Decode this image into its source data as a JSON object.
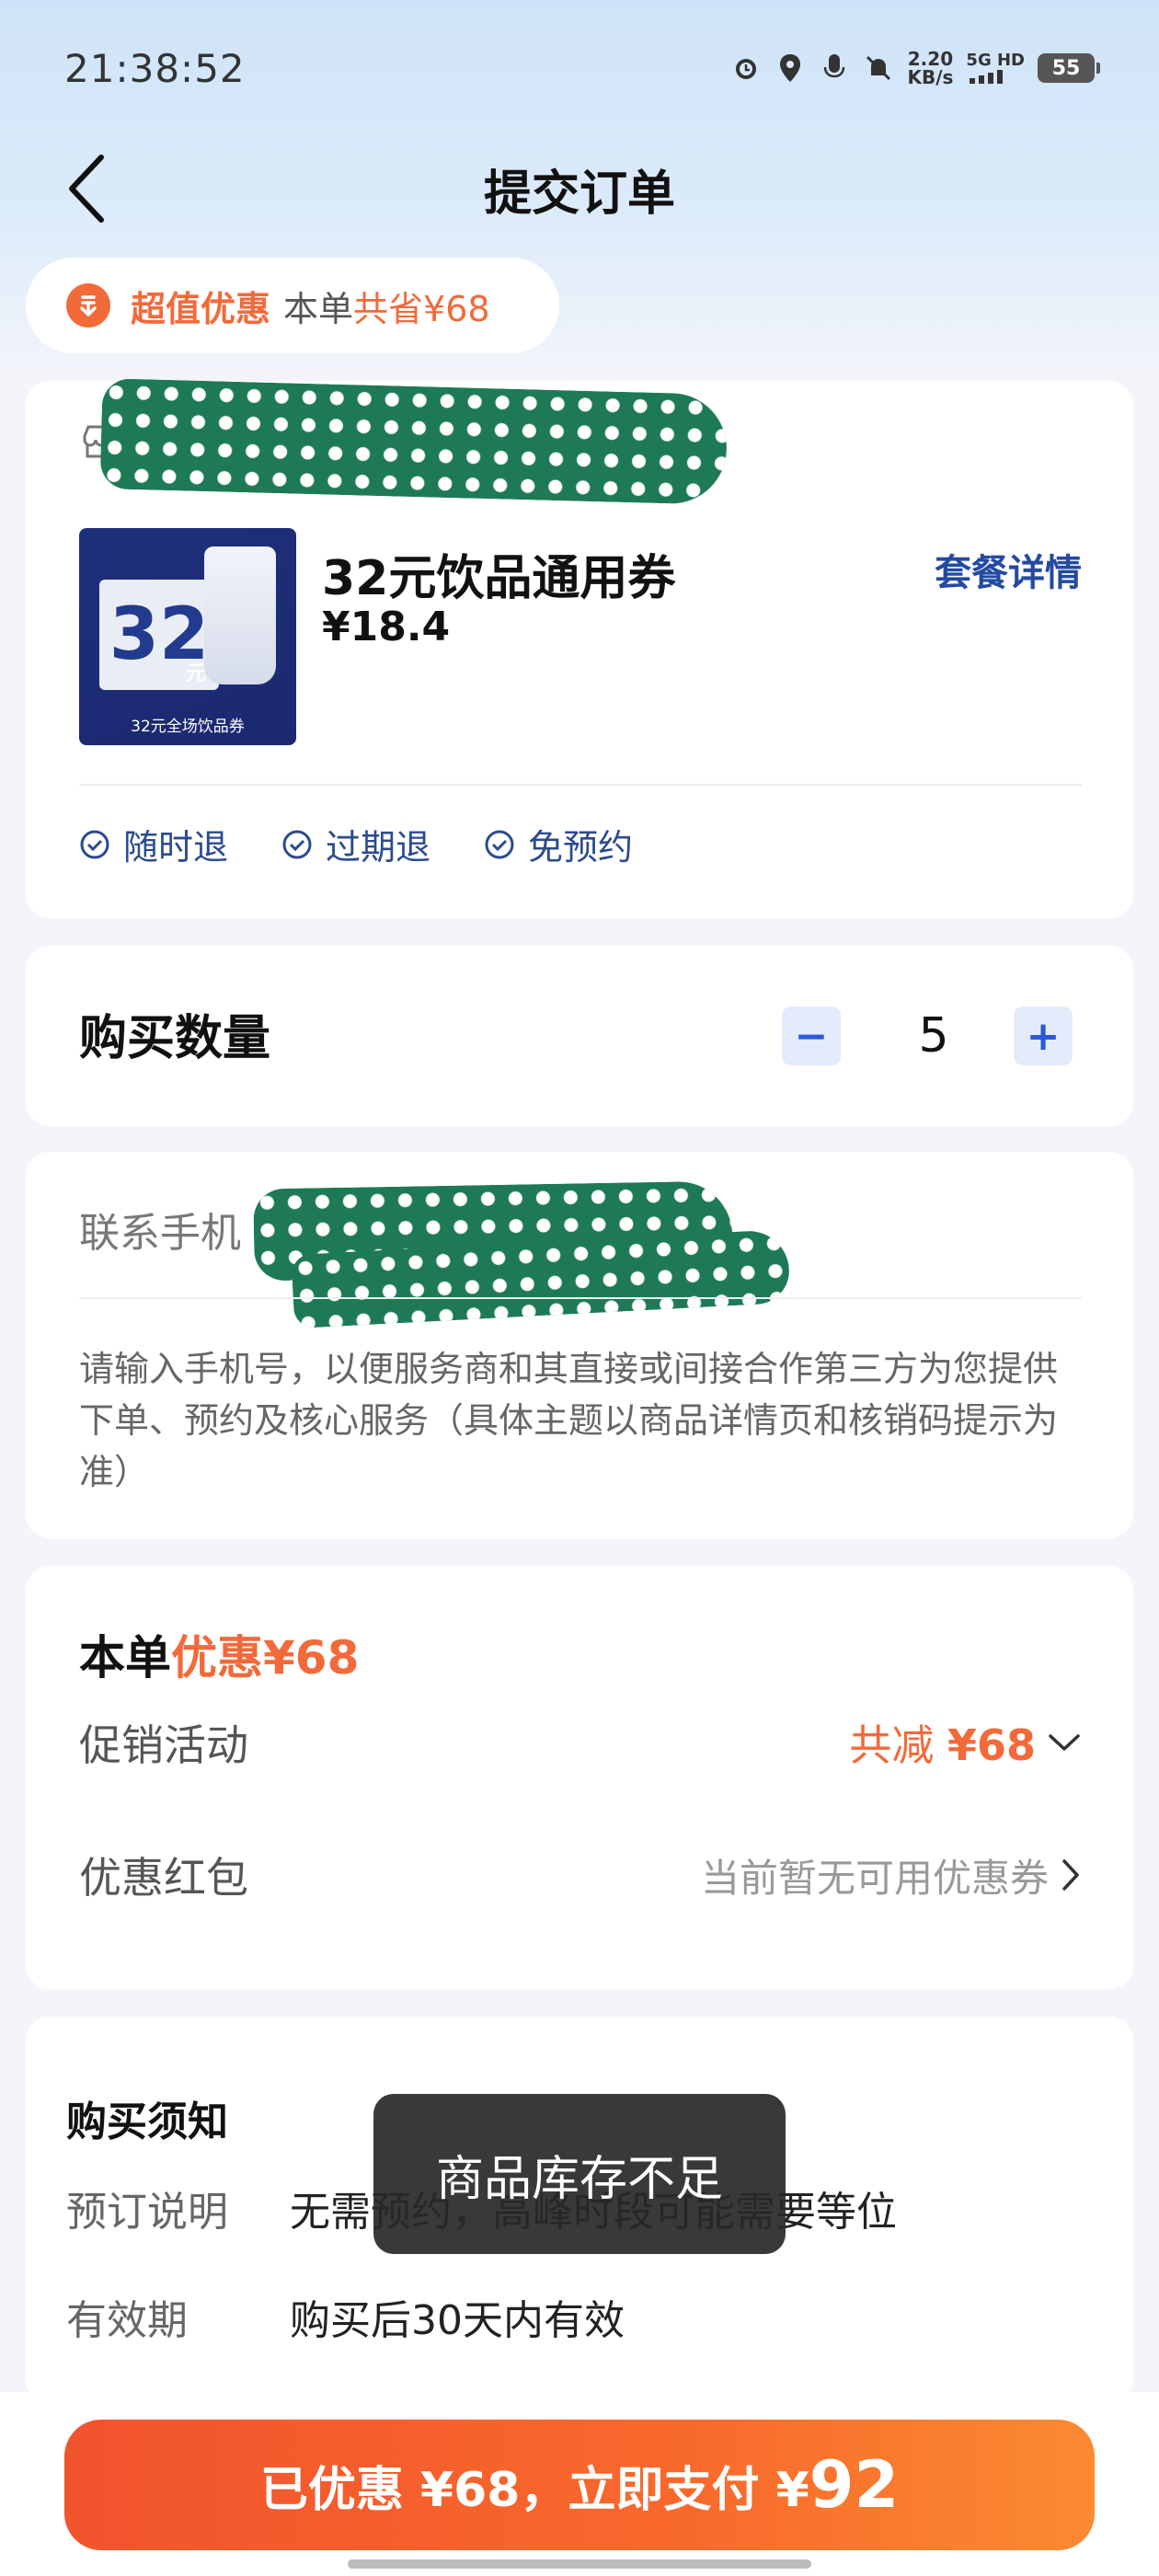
{
  "status_bar": {
    "time": "21:38:52",
    "net_speed_value": "2.20",
    "net_speed_unit": "KB/s",
    "network_type": "5G HD",
    "battery": "55"
  },
  "header": {
    "title": "提交订单"
  },
  "promo": {
    "strong": "超值优惠",
    "text": "本单",
    "save": "共省¥68"
  },
  "product": {
    "store_name": "瑞",
    "title": "32元饮品通用券",
    "price": "¥18.4",
    "detail_link": "套餐详情",
    "image_number": "32",
    "image_unit": "元",
    "image_caption": "32元全场饮品券",
    "tags": [
      "随时退",
      "过期退",
      "免预约"
    ]
  },
  "quantity": {
    "label": "购买数量",
    "value": "5",
    "minus": "−",
    "plus": "+"
  },
  "contact": {
    "label": "联系手机",
    "note": "请输入手机号，以便服务商和其直接或间接合作第三方为您提供下单、预约及核心服务（具体主题以商品详情页和核销码提示为准）"
  },
  "discount": {
    "title_prefix": "本单",
    "title_highlight": "优惠¥68",
    "promotion_label": "促销活动",
    "promotion_prefix": "共减 ",
    "promotion_amount": "¥68",
    "coupon_label": "优惠红包",
    "coupon_value": "当前暂无可用优惠券"
  },
  "notice": {
    "title": "购买须知",
    "rows": [
      {
        "key": "预订说明",
        "value": "无需预约，高峰时段可能需要等位"
      },
      {
        "key": "有效期",
        "value": "购买后30天内有效"
      }
    ]
  },
  "toast": {
    "text": "商品库存不足"
  },
  "pay": {
    "prefix": "已优惠 ¥68，立即支付 ¥",
    "amount": "92"
  },
  "colors": {
    "accent": "#f26a3a",
    "link": "#244aa0",
    "stepper": "#2a5bd7"
  }
}
